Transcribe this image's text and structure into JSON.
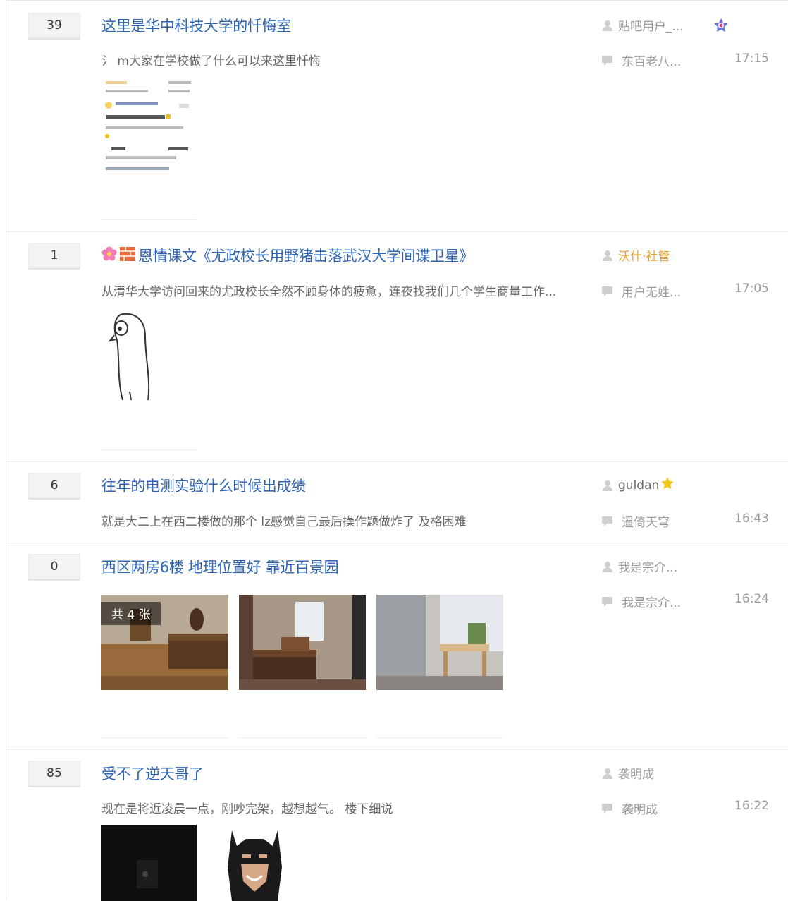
{
  "threads": [
    {
      "reply_count": "39",
      "title": "这里是华中科技大学的忏悔室",
      "abstract": "氵 m大家在学校做了什么可以来这里忏悔",
      "author": "贴吧用户_...",
      "last_replier": "东百老八...",
      "time": "17:15"
    },
    {
      "reply_count": "1",
      "title": "恩情课文《尤政校长用野猪击落武汉大学间谍卫星》",
      "abstract": "从清华大学访问回来的尤政校长全然不顾身体的疲惫，连夜找我们几个学生商量工作...",
      "author": "沃什·社管",
      "last_replier": "用户无姓...",
      "time": "17:05"
    },
    {
      "reply_count": "6",
      "title": "往年的电测实验什么时候出成绩",
      "abstract": "就是大二上在西二楼做的那个 lz感觉自己最后操作题做炸了 及格困难",
      "author": "guldan",
      "last_replier": "遥倚天穹",
      "time": "16:43"
    },
    {
      "reply_count": "0",
      "title": "西区两房6楼 地理位置好 靠近百景园",
      "image_count_badge": "共 4 张",
      "author": "我是宗介...",
      "last_replier": "我是宗介...",
      "time": "16:24"
    },
    {
      "reply_count": "85",
      "title": "受不了逆天哥了",
      "abstract": "现在是将近凌晨一点，刚吵完架，越想越气。 楼下细说",
      "author": "袭明成",
      "last_replier": "袭明成",
      "time": "16:22"
    }
  ],
  "colors": {
    "title_link": "#2d64b3",
    "manager_name": "#f0a030",
    "meta_gray": "#999999",
    "star_gold": "#f5c518"
  },
  "icons": [
    "user-icon",
    "reply-icon",
    "flower-icon",
    "brick-icon",
    "star-icon",
    "member-badge-icon"
  ]
}
